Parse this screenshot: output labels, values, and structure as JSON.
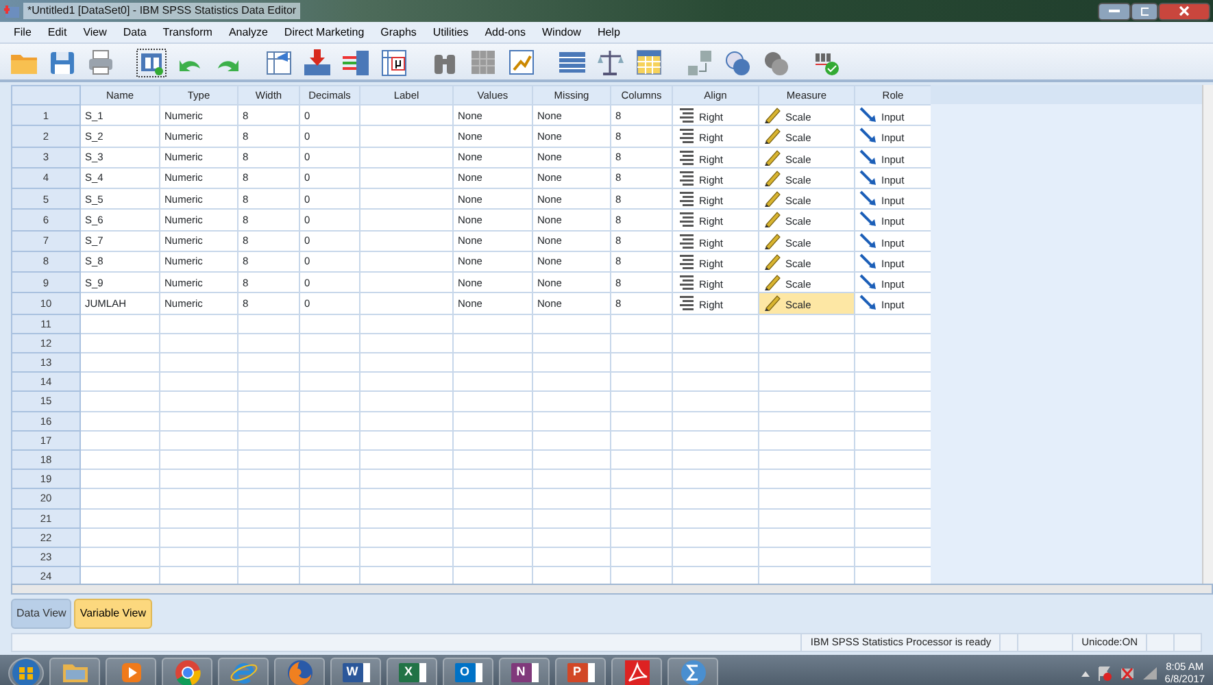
{
  "window": {
    "title": "*Untitled1 [DataSet0] - IBM SPSS Statistics Data Editor"
  },
  "menu": [
    "File",
    "Edit",
    "View",
    "Data",
    "Transform",
    "Analyze",
    "Direct Marketing",
    "Graphs",
    "Utilities",
    "Add-ons",
    "Window",
    "Help"
  ],
  "table": {
    "columns": [
      "Name",
      "Type",
      "Width",
      "Decimals",
      "Label",
      "Values",
      "Missing",
      "Columns",
      "Align",
      "Measure",
      "Role"
    ],
    "rows": [
      {
        "number": "1",
        "cells": [
          "S_1",
          "Numeric",
          "8",
          "0",
          "",
          "None",
          "None",
          "8",
          "Right",
          "Scale",
          "Input"
        ],
        "measure_selected": false
      },
      {
        "number": "2",
        "cells": [
          "S_2",
          "Numeric",
          "8",
          "0",
          "",
          "None",
          "None",
          "8",
          "Right",
          "Scale",
          "Input"
        ],
        "measure_selected": false
      },
      {
        "number": "3",
        "cells": [
          "S_3",
          "Numeric",
          "8",
          "0",
          "",
          "None",
          "None",
          "8",
          "Right",
          "Scale",
          "Input"
        ],
        "measure_selected": false
      },
      {
        "number": "4",
        "cells": [
          "S_4",
          "Numeric",
          "8",
          "0",
          "",
          "None",
          "None",
          "8",
          "Right",
          "Scale",
          "Input"
        ],
        "measure_selected": false
      },
      {
        "number": "5",
        "cells": [
          "S_5",
          "Numeric",
          "8",
          "0",
          "",
          "None",
          "None",
          "8",
          "Right",
          "Scale",
          "Input"
        ],
        "measure_selected": false
      },
      {
        "number": "6",
        "cells": [
          "S_6",
          "Numeric",
          "8",
          "0",
          "",
          "None",
          "None",
          "8",
          "Right",
          "Scale",
          "Input"
        ],
        "measure_selected": false
      },
      {
        "number": "7",
        "cells": [
          "S_7",
          "Numeric",
          "8",
          "0",
          "",
          "None",
          "None",
          "8",
          "Right",
          "Scale",
          "Input"
        ],
        "measure_selected": false
      },
      {
        "number": "8",
        "cells": [
          "S_8",
          "Numeric",
          "8",
          "0",
          "",
          "None",
          "None",
          "8",
          "Right",
          "Scale",
          "Input"
        ],
        "measure_selected": false
      },
      {
        "number": "9",
        "cells": [
          "S_9",
          "Numeric",
          "8",
          "0",
          "",
          "None",
          "None",
          "8",
          "Right",
          "Scale",
          "Input"
        ],
        "measure_selected": false
      },
      {
        "number": "10",
        "cells": [
          "JUMLAH",
          "Numeric",
          "8",
          "0",
          "",
          "None",
          "None",
          "8",
          "Right",
          "Scale",
          "Input"
        ],
        "measure_selected": true
      }
    ],
    "empty_rows": [
      "11",
      "12",
      "13",
      "14",
      "15",
      "16",
      "17",
      "18",
      "19",
      "20",
      "21",
      "22",
      "23",
      "24"
    ]
  },
  "tabs": [
    {
      "label": "Data View",
      "selected": false
    },
    {
      "label": "Variable View",
      "selected": true
    }
  ],
  "status_bar": {
    "message": "IBM SPSS Statistics Processor is ready",
    "encoding": "Unicode:ON"
  },
  "taskbar": {
    "items": [
      {
        "kind": "start"
      },
      {
        "kind": "folder"
      },
      {
        "kind": "media"
      },
      {
        "kind": "chrome"
      },
      {
        "kind": "ie"
      },
      {
        "kind": "firefox"
      },
      {
        "kind": "office",
        "letter": "W",
        "color": "#2b579a"
      },
      {
        "kind": "office",
        "letter": "X",
        "color": "#217346"
      },
      {
        "kind": "office",
        "letter": "O",
        "color": "#0072c6"
      },
      {
        "kind": "office",
        "letter": "N",
        "color": "#80397b"
      },
      {
        "kind": "office",
        "letter": "P",
        "color": "#d24726"
      },
      {
        "kind": "acrobat"
      },
      {
        "kind": "spss"
      }
    ],
    "time": "8:05 AM",
    "date": "6/8/2017"
  }
}
